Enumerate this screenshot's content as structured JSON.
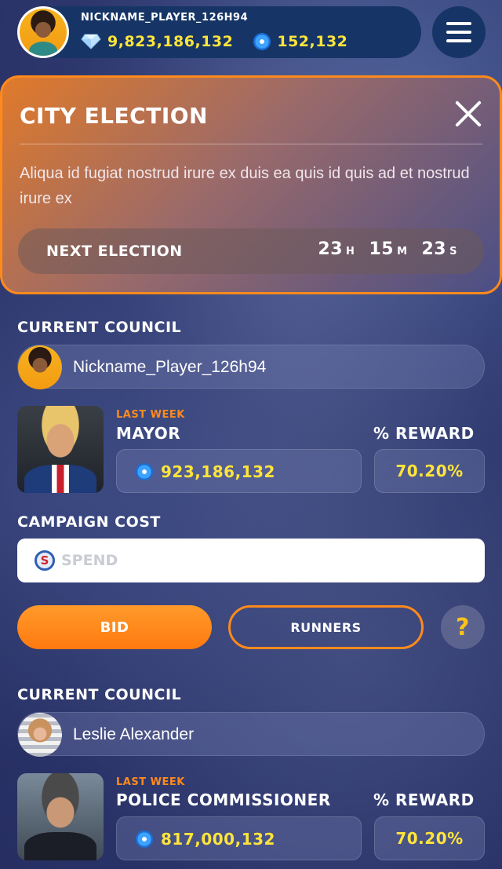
{
  "header": {
    "nickname": "NICKNAME_PLAYER_126H94",
    "gems": "9,823,186,132",
    "coins": "152,132",
    "menu_icon": "hamburger-menu-icon"
  },
  "election": {
    "title": "CITY ELECTION",
    "description": "Aliqua id fugiat nostrud irure ex duis ea quis id quis ad et nostrud irure ex",
    "next_label": "NEXT ELECTION",
    "hours": "23",
    "hours_unit": "H",
    "minutes": "15",
    "minutes_unit": "M",
    "seconds": "23",
    "seconds_unit": "S"
  },
  "council1": {
    "section_title": "CURRENT COUNCIL",
    "player_name": "Nickname_Player_126h94",
    "last_week": "LAST WEEK",
    "role": "MAYOR",
    "reward_label": "% REWARD",
    "amount": "923,186,132",
    "reward_pct": "70.20%"
  },
  "campaign": {
    "title": "CAMPAIGN COST",
    "placeholder": "SPEND",
    "bid_label": "BID",
    "runners_label": "RUNNERS",
    "help_label": "?"
  },
  "council2": {
    "section_title": "CURRENT COUNCIL",
    "player_name": "Leslie Alexander",
    "last_week": "LAST WEEK",
    "role": "POLICE COMMISSIONER",
    "reward_label": "% REWARD",
    "amount": "817,000,132",
    "reward_pct": "70.20%"
  },
  "colors": {
    "accent": "#ff8a1c",
    "highlight": "#ffe53b",
    "topbar": "#163566"
  }
}
